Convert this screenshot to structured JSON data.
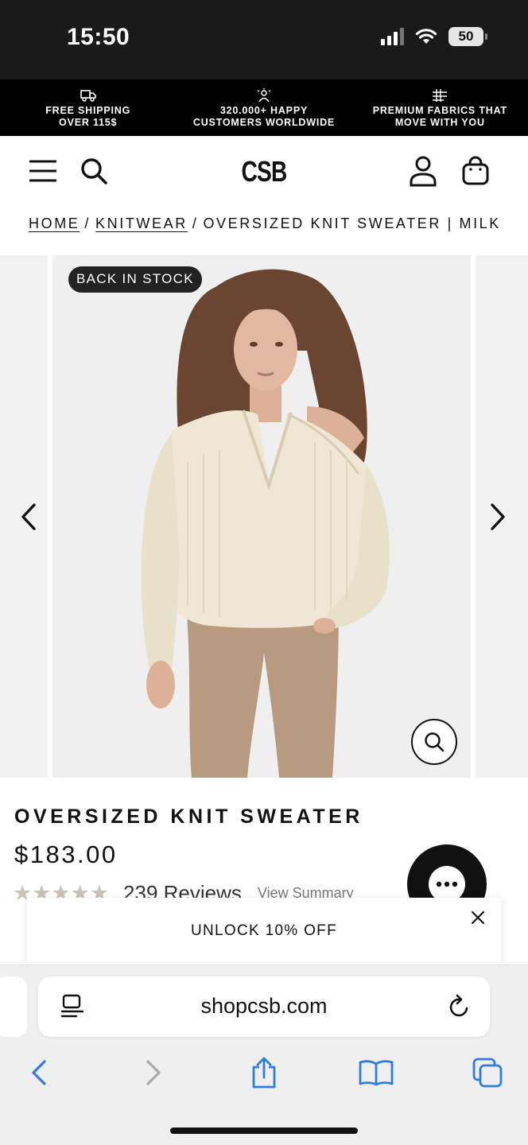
{
  "status_bar": {
    "time": "15:50",
    "battery": "50"
  },
  "promo_bar": {
    "items": [
      {
        "icon": "delivery-truck-icon",
        "text": "FREE SHIPPING\nOVER 115$"
      },
      {
        "icon": "happy-person-icon",
        "text": "320.000+ HAPPY\nCUSTOMERS WORLDWIDE"
      },
      {
        "icon": "fabric-grid-icon",
        "text": "PREMIUM FABRICS THAT\nMOVE WITH YOU"
      }
    ]
  },
  "header": {
    "logo": "CSB",
    "icons": [
      "menu-icon",
      "search-icon",
      "account-icon",
      "shopping-bag-icon"
    ]
  },
  "breadcrumb": {
    "home": "HOME",
    "category": "KNITWEAR",
    "current": "OVERSIZED KNIT SWEATER | MILK",
    "separator": "/"
  },
  "gallery": {
    "badge": "BACK IN STOCK",
    "colors": {
      "sweater": "#efe7d3",
      "leggings": "#b89a80",
      "hair": "#6a4632",
      "skin": "#e2b9a0"
    }
  },
  "product": {
    "title": "OVERSIZED KNIT SWEATER",
    "price": "$183.00",
    "rating_stars": "★★★★★",
    "review_count": "239 Reviews",
    "view_summary": "View Summary"
  },
  "popup": {
    "text": "UNLOCK 10% OFF"
  },
  "browser": {
    "url": "shopcsb.com",
    "accent": "#2f7de1"
  }
}
